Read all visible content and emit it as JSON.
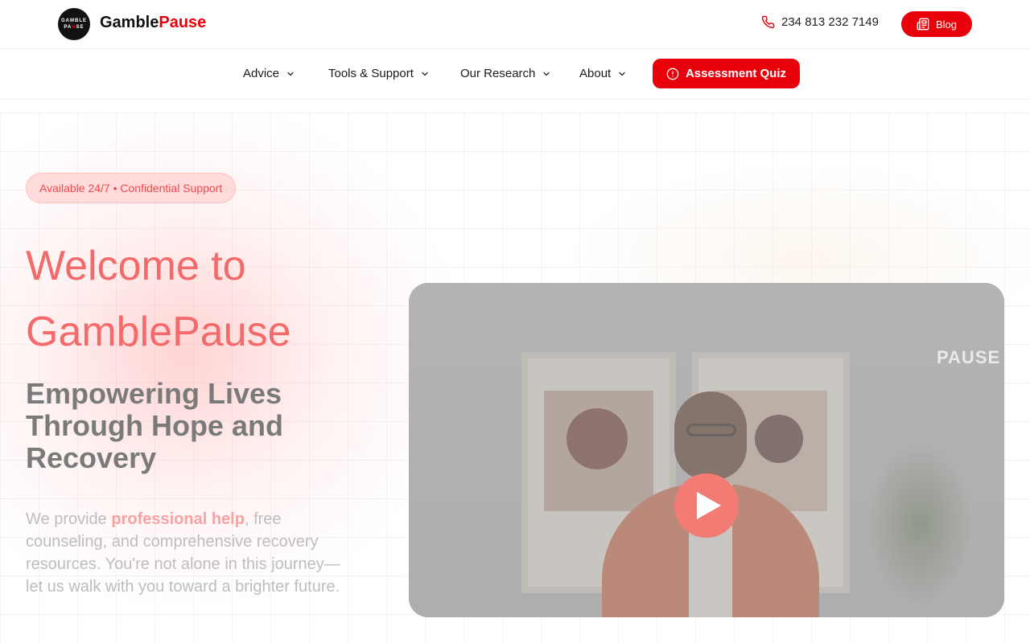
{
  "header": {
    "logo_text_top": "GAMBLE",
    "logo_text_mid_a": "PA",
    "logo_text_mid_b": "U",
    "logo_text_mid_c": "SE",
    "brand_part1": "Gamble",
    "brand_part2": "Pause",
    "phone": "234 813 232 7149",
    "blog_label": "Blog",
    "accent_color": "#e8000b"
  },
  "nav": {
    "items": [
      {
        "label": "Advice",
        "icon": "chevron-down-icon"
      },
      {
        "label": "Tools & Support",
        "icon": "chevron-down-icon"
      },
      {
        "label": "Our Research",
        "icon": "chevron-down-icon"
      },
      {
        "label": "About",
        "icon": "chevron-down-icon"
      }
    ],
    "cta_label": "Assessment Quiz",
    "cta_icon": "alert-circle-icon"
  },
  "hero": {
    "badge": "Available 24/7 • Confidential Support",
    "title_line1": "Welcome to",
    "title_line2": "GamblePause",
    "subtitle": "Empowering Lives Through Hope and Recovery",
    "desc_before": "We provide ",
    "desc_highlight": "professional help",
    "desc_after": ", free counseling, and comprehensive recovery resources. You're not alone in this journey—let us walk with you toward a brighter future."
  },
  "video": {
    "watermark": "PAUSE",
    "play_icon": "play-icon"
  }
}
